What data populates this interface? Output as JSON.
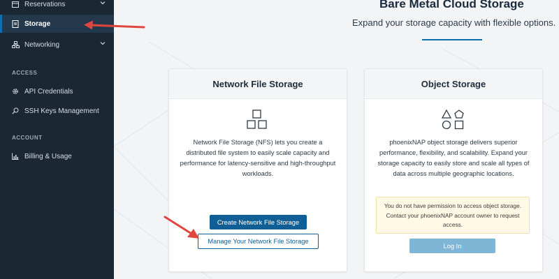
{
  "sidebar": {
    "items": [
      {
        "label": "Reservations",
        "icon": "calendar-icon"
      },
      {
        "label": "Storage",
        "icon": "storage-icon"
      },
      {
        "label": "Networking",
        "icon": "network-icon"
      }
    ],
    "sections": [
      {
        "label": "ACCESS",
        "items": [
          {
            "label": "API Credentials",
            "icon": "gear-icon"
          },
          {
            "label": "SSH Keys Management",
            "icon": "key-search-icon"
          }
        ]
      },
      {
        "label": "ACCOUNT",
        "items": [
          {
            "label": "Billing & Usage",
            "icon": "bar-chart-icon"
          }
        ]
      }
    ]
  },
  "hero": {
    "title": "Bare Metal Cloud Storage",
    "subtitle": "Expand your storage capacity with flexible options."
  },
  "nfs_card": {
    "title": "Network File Storage",
    "icon": "squares-icon",
    "description": "Network File Storage (NFS) lets you create a distributed file system to easily scale capacity and performance for latency-sensitive and high-throughput workloads.",
    "create_button": "Create Network File Storage",
    "manage_button": "Manage Your Network File Storage"
  },
  "object_card": {
    "title": "Object Storage",
    "icon": "shapes-icon",
    "description": "phoenixNAP object storage delivers superior performance, flexibility, and scalability. Expand your storage capacity to easily store and scale all types of data across multiple geographic locations.",
    "notice": "You do not have permission to access object storage. Contact your phoenixNAP account owner to request access.",
    "login_button": "Log In"
  },
  "colors": {
    "sidebar_bg": "#1b2733",
    "accent": "#0f5f96",
    "annotation_arrow": "#e0463f"
  }
}
